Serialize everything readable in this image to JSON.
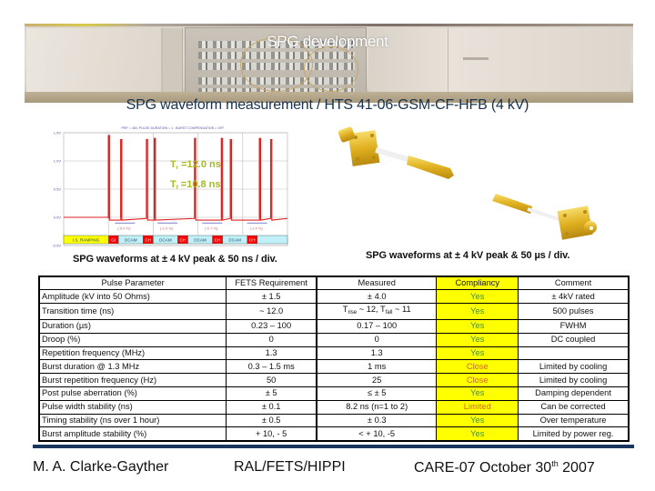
{
  "slide": {
    "photo_title": "SPG development",
    "heading": "SPG waveform measurement / HTS 41-06-GSM-CF-HFB (4 kV)",
    "caption_left": "SPG waveforms at ± 4 kV peak & 50 ns / div.",
    "caption_right": "SPG waveforms at ± 4 kV peak & 50 µs / div."
  },
  "chart_data": {
    "type": "line",
    "title": "PRF = 400; PULSE DURATION = 1 ; BURST COMPENSATION = OFF",
    "ytick_labels": [
      "1.5V",
      "1.0V",
      "0.5V",
      "0.0V",
      "-0.5V"
    ],
    "ylim": [
      -0.5,
      1.5
    ],
    "grid": true,
    "series_color": "#e02020",
    "annotations": [
      {
        "label": "Tr",
        "text": "=12.0 ns"
      },
      {
        "label": "Tf",
        "text": "=10.8 ns"
      }
    ],
    "annotation_color": "#a8b820",
    "pulses": [
      {
        "x": 0.2,
        "peak": 1.45
      },
      {
        "x": 0.255,
        "peak": 1.38
      },
      {
        "x": 0.37,
        "peak": 1.38
      },
      {
        "x": 0.405,
        "peak": 1.4
      },
      {
        "x": 0.585,
        "peak": 1.4
      },
      {
        "x": 0.705,
        "peak": 1.4
      },
      {
        "x": 0.745,
        "peak": 1.38
      },
      {
        "x": 0.875,
        "peak": 1.4
      },
      {
        "x": 0.925,
        "peak": 1.38
      }
    ],
    "phase_bar": [
      {
        "label": "I.S. RAMPING",
        "color": "#ffff00"
      },
      {
        "label": "GI",
        "color": "#ff0000"
      },
      {
        "label": "DCAM",
        "color": "#c0f0f8"
      },
      {
        "label": "CH",
        "color": "#ff0000"
      },
      {
        "label": "DCAM",
        "color": "#c0f0f8"
      },
      {
        "label": "CH",
        "color": "#ff0000"
      },
      {
        "label": "DCAM",
        "color": "#c0f0f8"
      },
      {
        "label": "CH",
        "color": "#ff0000"
      },
      {
        "label": "DCAM",
        "color": "#c0f0f8"
      },
      {
        "label": "CH",
        "color": "#ff0000"
      },
      {
        "label": "",
        "color": "#c0f0f8"
      }
    ],
    "droop_labels": [
      "(-5.0 %)",
      "(-1.0 %)",
      "(-0.7 %)",
      "(-1.4 %)"
    ]
  },
  "table": {
    "headers": [
      "Pulse Parameter",
      "FETS Requirement",
      "Measured",
      "Compliancy",
      "Comment"
    ],
    "rows": [
      {
        "param": "Amplitude (kV into 50 Ohms)",
        "req": "± 1.5",
        "meas": "± 4.0",
        "comp": "Yes",
        "comp_status": "yes",
        "comment": "± 4kV rated"
      },
      {
        "param": "Transition time (ns)",
        "req": "~ 12.0",
        "meas": "T_rise ~ 12, T_fall ~ 11",
        "comp": "Yes",
        "comp_status": "yes",
        "comment": "500 pulses"
      },
      {
        "param": "Duration (µs)",
        "req": "0.23 – 100",
        "meas": "0.17 – 100",
        "comp": "Yes",
        "comp_status": "yes",
        "comment": "FWHM"
      },
      {
        "param": "Droop (%)",
        "req": "0",
        "meas": "0",
        "comp": "Yes",
        "comp_status": "yes",
        "comment": "DC coupled"
      },
      {
        "param": "Repetition frequency (MHz)",
        "req": "1.3",
        "meas": "1.3",
        "comp": "Yes",
        "comp_status": "yes",
        "comment": ""
      },
      {
        "param": "Burst duration  @ 1.3 MHz",
        "req": "0.3 – 1.5 ms",
        "meas": "1 ms",
        "comp": "Close",
        "comp_status": "close",
        "comment": "Limited by cooling"
      },
      {
        "param": "Burst repetition frequency (Hz)",
        "req": "50",
        "meas": "25",
        "comp": "Close",
        "comp_status": "close",
        "comment": "Limited by cooling"
      },
      {
        "param": "Post pulse aberration (%)",
        "req": "± 5",
        "meas": "≤ ± 5",
        "comp": "Yes",
        "comp_status": "yes",
        "comment": "Damping dependent"
      },
      {
        "param": "Pulse width stability (ns)",
        "req": "± 0.1",
        "meas": "8.2 ns (n=1 to 2)",
        "comp": "Limited",
        "comp_status": "limited",
        "comment": "Can be corrected"
      },
      {
        "param": "Timing stability (ns over 1 hour)",
        "req": "± 0.5",
        "meas": "± 0.3",
        "comp": "Yes",
        "comp_status": "yes",
        "comment": "Over temperature"
      },
      {
        "param": "Burst amplitude stability (%)",
        "req": "+ 10, - 5",
        "meas": "< + 10, -5",
        "comp": "Yes",
        "comp_status": "yes",
        "comment": "Limited by power reg."
      }
    ],
    "trans_meas": {
      "pre1": "T",
      "sub1": "rise",
      "mid": " ~ 12, T",
      "sub2": "fall",
      "post": " ~ 11"
    }
  },
  "footer": {
    "author": "M. A. Clarke-Gayther",
    "org": "RAL/FETS/HIPPI",
    "event_pre": "CARE-07 October 30",
    "event_sup": "th",
    "event_post": " 2007"
  },
  "colors": {
    "heading": "#16324f",
    "footer_rule": "#17375e",
    "compliancy_bg": "#ffff00",
    "status_yes": "#3c8c3c",
    "status_close": "#d2691e",
    "status_limited": "#d2691e"
  }
}
